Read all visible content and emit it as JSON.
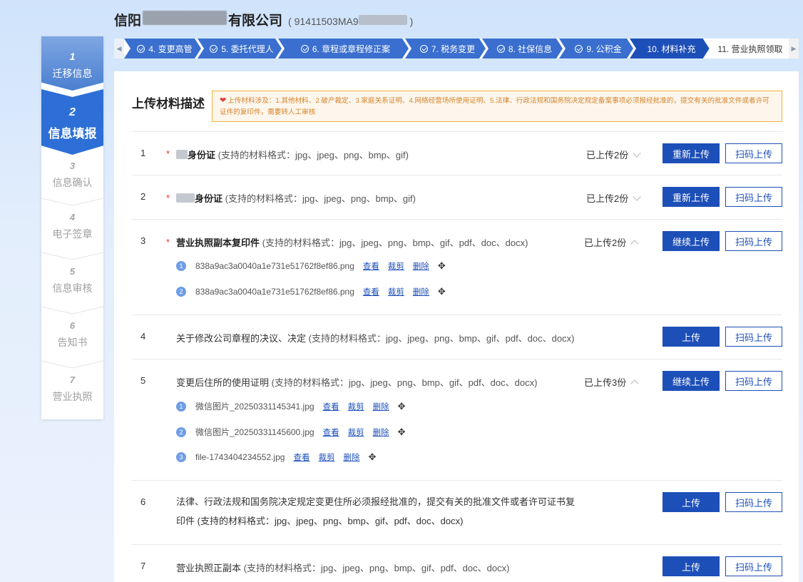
{
  "header": {
    "company_prefix": "信阳",
    "company_suffix": "有限公司",
    "code_prefix": "( 91411503MA9",
    "code_suffix": ")"
  },
  "steps": [
    {
      "num": "1",
      "label": "迁移信息"
    },
    {
      "num": "2",
      "label": "信息填报"
    },
    {
      "num": "3",
      "label": "信息确认"
    },
    {
      "num": "4",
      "label": "电子签章"
    },
    {
      "num": "5",
      "label": "信息审核"
    },
    {
      "num": "6",
      "label": "告知书"
    },
    {
      "num": "7",
      "label": "营业执照"
    }
  ],
  "tabs": [
    {
      "label": "4. 变更高管"
    },
    {
      "label": "5. 委托代理人"
    },
    {
      "label": "6. 章程或章程修正案"
    },
    {
      "label": "7. 税务变更"
    },
    {
      "label": "8. 社保信息"
    },
    {
      "label": "9. 公积金"
    },
    {
      "label": "10. 材料补充"
    },
    {
      "label": "11. 营业执照领取"
    }
  ],
  "main": {
    "title": "上传材料描述",
    "notice": "上传材料涉及：1.其他材料、2.破产裁定、3.家庭关系证明、4.网络经营场所使用证明、5.法律、行政法规和国务院决定规定备案事项必须报经批准的，提交有关的批准文件或者许可证件的复印件，需要转人工审核"
  },
  "rows": [
    {
      "num": "1",
      "name": "身份证",
      "fmt": "(支持的材料格式：jpg、jpeg、png、bmp、gif)",
      "count": "已上传2份",
      "primary": "重新上传",
      "secondary": "扫码上传"
    },
    {
      "num": "2",
      "name": "身份证",
      "fmt": "(支持的材料格式：jpg、jpeg、png、bmp、gif)",
      "count": "已上传2份",
      "primary": "重新上传",
      "secondary": "扫码上传"
    },
    {
      "num": "3",
      "name": "营业执照副本复印件",
      "fmt": "(支持的材料格式：jpg、jpeg、png、bmp、gif、pdf、doc、docx)",
      "count": "已上传2份",
      "primary": "继续上传",
      "secondary": "扫码上传",
      "files": [
        {
          "idx": "1",
          "name": "838a9ac3a0040a1e731e51762f8ef86.png"
        },
        {
          "idx": "2",
          "name": "838a9ac3a0040a1e731e51762f8ef86.png"
        }
      ]
    },
    {
      "num": "4",
      "name": "关于修改公司章程的决议、决定",
      "fmt": "(支持的材料格式：jpg、jpeg、png、bmp、gif、pdf、doc、docx)",
      "primary": "上传",
      "secondary": "扫码上传"
    },
    {
      "num": "5",
      "name": "变更后住所的使用证明",
      "fmt": "(支持的材料格式：jpg、jpeg、png、bmp、gif、pdf、doc、docx)",
      "count": "已上传3份",
      "primary": "继续上传",
      "secondary": "扫码上传",
      "files": [
        {
          "idx": "1",
          "name": "微信图片_20250331145341.jpg"
        },
        {
          "idx": "2",
          "name": "微信图片_20250331145600.jpg"
        },
        {
          "idx": "3",
          "name": "file-1743404234552.jpg"
        }
      ]
    },
    {
      "num": "6",
      "line1": "法律、行政法规和国务院决定规定变更住所必须报经批准的，提交有关的批准文件或者许可证书复",
      "line2": "印件 (支持的材料格式：jpg、jpeg、png、bmp、gif、pdf、doc、docx)",
      "primary": "上传",
      "secondary": "扫码上传"
    },
    {
      "num": "7",
      "name": "营业执照正副本",
      "fmt": "(支持的材料格式：jpg、jpeg、png、bmp、gif、pdf、doc、docx)",
      "primary": "上传",
      "secondary": "扫码上传"
    }
  ],
  "file_actions": {
    "view": "查看",
    "crop": "裁剪",
    "delete": "删除"
  },
  "icons": {
    "move": "move-icon",
    "heart": "heart-icon",
    "check": "check-circle-icon",
    "chevron": "chevron-icon"
  },
  "colors": {
    "primary": "#1d4fb8",
    "active_step": "#2d6fd6",
    "tab_done": "#3a6fcf",
    "tab_current": "#1d4fb8",
    "notice_border": "#f3b23a"
  }
}
